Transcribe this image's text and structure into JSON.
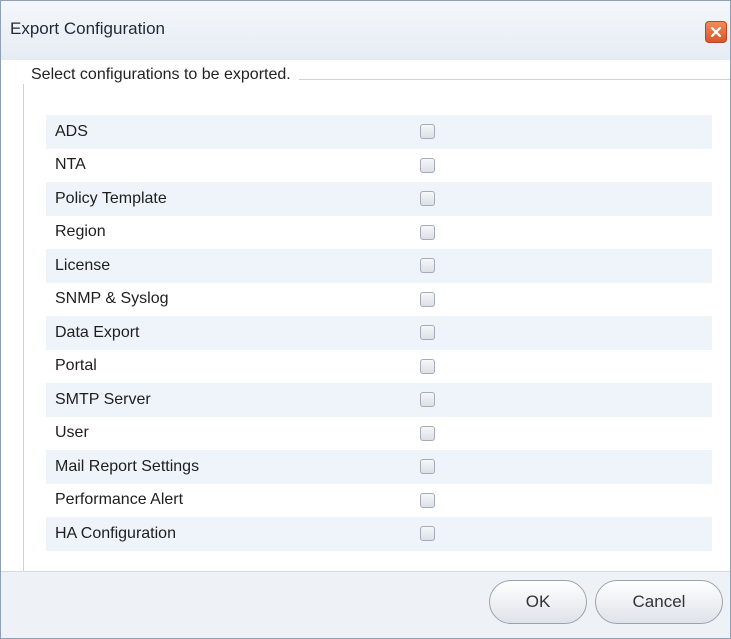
{
  "dialog": {
    "title": "Export Configuration",
    "legend": "Select configurations to be exported.",
    "items": [
      {
        "label": "ADS",
        "checked": false
      },
      {
        "label": "NTA",
        "checked": false
      },
      {
        "label": "Policy Template",
        "checked": false
      },
      {
        "label": "Region",
        "checked": false
      },
      {
        "label": "License",
        "checked": false
      },
      {
        "label": "SNMP & Syslog",
        "checked": false
      },
      {
        "label": "Data Export",
        "checked": false
      },
      {
        "label": "Portal",
        "checked": false
      },
      {
        "label": "SMTP Server",
        "checked": false
      },
      {
        "label": "User",
        "checked": false
      },
      {
        "label": "Mail Report Settings",
        "checked": false
      },
      {
        "label": "Performance Alert",
        "checked": false
      },
      {
        "label": "HA Configuration",
        "checked": false
      }
    ],
    "buttons": {
      "ok": "OK",
      "cancel": "Cancel"
    },
    "icons": {
      "close": "close-icon"
    },
    "colors": {
      "close_button": "#e06a3a",
      "alt_row": "#eef4fa"
    }
  }
}
